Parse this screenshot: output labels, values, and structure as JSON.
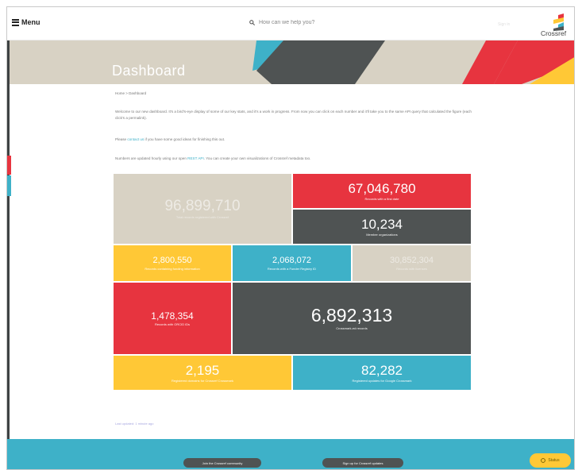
{
  "header": {
    "menu_label": "Menu",
    "search_placeholder": "How can we help you?",
    "signin_text": "Sign in",
    "logo_text": "Crossref"
  },
  "banner": {
    "title": "Dashboard"
  },
  "breadcrumb": {
    "home": "Home",
    "separator": " > ",
    "current": "Dashboard"
  },
  "intro": {
    "text": "Welcome to our new dashboard. It's a bird's-eye display of some of our key stats, and it's a work in progress. From now you can click on each number and it'll take you to the same API query that calculated the figure (each click's a permalink).",
    "please_prefix": "Please ",
    "please_link": "contact us",
    "please_suffix": " if you have some good ideas for finishing this out.",
    "api_prefix": "Numbers are updated hourly using our open ",
    "api_link": "REST API",
    "api_suffix": ". You can create your own visualizations of Crossref metadata too."
  },
  "stats": {
    "total_records": {
      "value": "96,899,710",
      "label": "Total records registered with Crossref"
    },
    "first_date": {
      "value": "67,046,780",
      "label": "Records with a first date"
    },
    "member_orgs": {
      "value": "10,234",
      "label": "Member organizations"
    },
    "funding_info": {
      "value": "2,800,550",
      "label": "Records containing funding information"
    },
    "registry_ids": {
      "value": "2,068,072",
      "label": "Records with a Funder Registry ID"
    },
    "with_licenses": {
      "value": "30,852,304",
      "label": "Records with licenses"
    },
    "orcid_ids": {
      "value": "1,478,354",
      "label": "Records with ORCID iDs"
    },
    "crossmark": {
      "value": "6,892,313",
      "label": "Crossmark-ed records"
    },
    "crossmark_domains": {
      "value": "2,195",
      "label": "Registered domains for Crossref Crossmark"
    },
    "google_crossmark": {
      "value": "82,282",
      "label": "Registered updates for Google Crossmark"
    }
  },
  "updated_text": "Last updated: 1 minute ago",
  "footer": {
    "join_label": "Join the Crossref community",
    "signup_label": "Sign up for Crossref updates",
    "status_label": "Status"
  },
  "colors": {
    "beige": "#d8d2c4",
    "red": "#e7343f",
    "dark": "#4f5353",
    "yellow": "#ffc836",
    "blue": "#3eb1c8"
  }
}
